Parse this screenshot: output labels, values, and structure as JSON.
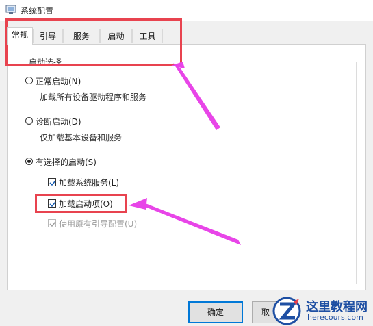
{
  "window": {
    "title": "系统配置"
  },
  "tabs": [
    {
      "label": "常规",
      "active": true
    },
    {
      "label": "引导",
      "active": false
    },
    {
      "label": "服务",
      "active": false
    },
    {
      "label": "启动",
      "active": false
    },
    {
      "label": "工具",
      "active": false
    }
  ],
  "startup_selection": {
    "legend": "启动选择",
    "normal": {
      "label": "正常启动(N)",
      "desc": "加载所有设备驱动程序和服务",
      "selected": false
    },
    "diagnostic": {
      "label": "诊断启动(D)",
      "desc": "仅加载基本设备和服务",
      "selected": false
    },
    "selective": {
      "label": "有选择的启动(S)",
      "selected": true,
      "options": [
        {
          "label": "加载系统服务(L)",
          "checked": true,
          "enabled": true
        },
        {
          "label": "加载启动项(O)",
          "checked": true,
          "enabled": true
        },
        {
          "label": "使用原有引导配置(U)",
          "checked": true,
          "enabled": false
        }
      ]
    }
  },
  "buttons": {
    "ok": "确定",
    "cancel": "取"
  },
  "watermark": {
    "title": "这里教程网",
    "site": "herecours.com"
  },
  "colors": {
    "highlight": "#e8434f",
    "arrow": "#e845e8",
    "focus": "#0078d7",
    "brand": "#1e4fa3"
  }
}
